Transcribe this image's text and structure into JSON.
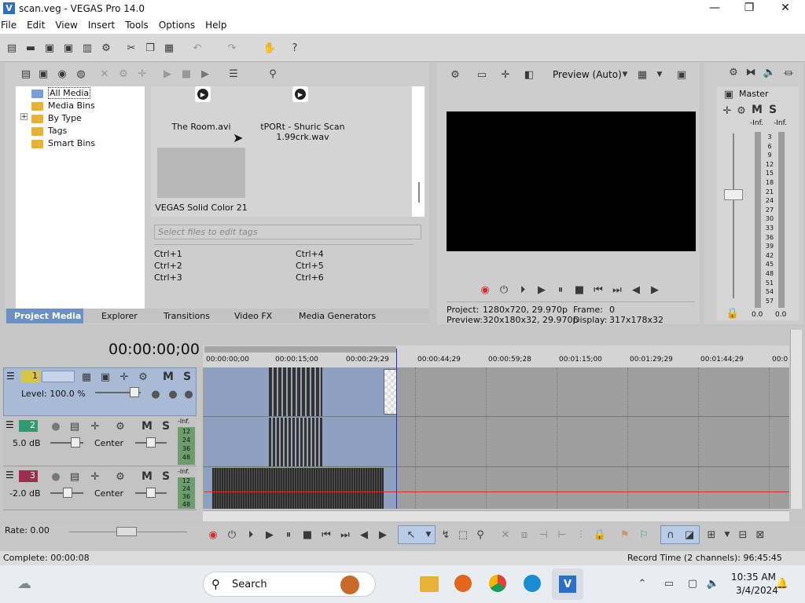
{
  "window": {
    "title": "scan.veg - VEGAS Pro 14.0",
    "min": "—",
    "max": "❐",
    "close": "✕"
  },
  "menu": [
    "File",
    "Edit",
    "View",
    "Insert",
    "Tools",
    "Options",
    "Help"
  ],
  "project_media": {
    "tree": [
      "All Media",
      "Media Bins",
      "By Type",
      "Tags",
      "Smart Bins"
    ],
    "expand": "+",
    "items": [
      {
        "name": "The Room.avi"
      },
      {
        "name": "tPORt - Shuric Scan 1.99crk.wav"
      },
      {
        "name": "VEGAS Solid Color 21"
      }
    ],
    "tag_placeholder": "Select files to edit tags",
    "shortcuts": [
      "Ctrl+1",
      "Ctrl+4",
      "Ctrl+2",
      "Ctrl+5",
      "Ctrl+3",
      "Ctrl+6"
    ]
  },
  "tabs": [
    "Project Media",
    "Explorer",
    "Transitions",
    "Video FX",
    "Media Generators"
  ],
  "preview": {
    "mode": "Preview (Auto)",
    "project_label": "Project:",
    "project": "1280x720, 29.970p",
    "preview_label": "Preview:",
    "preview_val": "320x180x32, 29.970p",
    "frame_label": "Frame:",
    "frame": "0",
    "display_label": "Display:",
    "display": "317x178x32"
  },
  "master": {
    "title": "Master",
    "m": "M",
    "s": "S",
    "inf1": "-Inf.",
    "inf2": "-Inf.",
    "scale": [
      "3",
      "6",
      "9",
      "12",
      "15",
      "18",
      "21",
      "24",
      "27",
      "30",
      "33",
      "36",
      "39",
      "42",
      "45",
      "48",
      "51",
      "54",
      "57"
    ],
    "v1": "0.0",
    "v2": "0.0"
  },
  "timeline": {
    "timecode": "00:00:00;00",
    "ruler": [
      "00:00:00;00",
      "00:00:15;00",
      "00:00:29;29",
      "00:00:44;29",
      "00:00:59;28",
      "00:01:15;00",
      "00:01:29;29",
      "00:01:44;29",
      "00:0"
    ],
    "tracks": [
      {
        "num": "1",
        "level": "Level: 100.0 %",
        "m": "M",
        "s": "S"
      },
      {
        "num": "2",
        "vol": "5.0 dB",
        "pan": "Center",
        "m": "M",
        "s": "S",
        "meter": [
          "-Inf.",
          "12",
          "24",
          "36",
          "48"
        ]
      },
      {
        "num": "3",
        "vol": "-2.0 dB",
        "pan": "Center",
        "m": "M",
        "s": "S",
        "meter": [
          "-Inf.",
          "12",
          "24",
          "36",
          "48"
        ]
      }
    ]
  },
  "rate": "Rate: 0.00",
  "status": {
    "left": "Complete: 00:00:08",
    "right": "Record Time (2 channels): 96:45:45"
  },
  "taskbar": {
    "search": "Search",
    "time": "10:35 AM",
    "date": "3/4/2024"
  },
  "colors": {
    "accent": "#1f6fd0",
    "timeline_sel": "#8ea0bf"
  }
}
